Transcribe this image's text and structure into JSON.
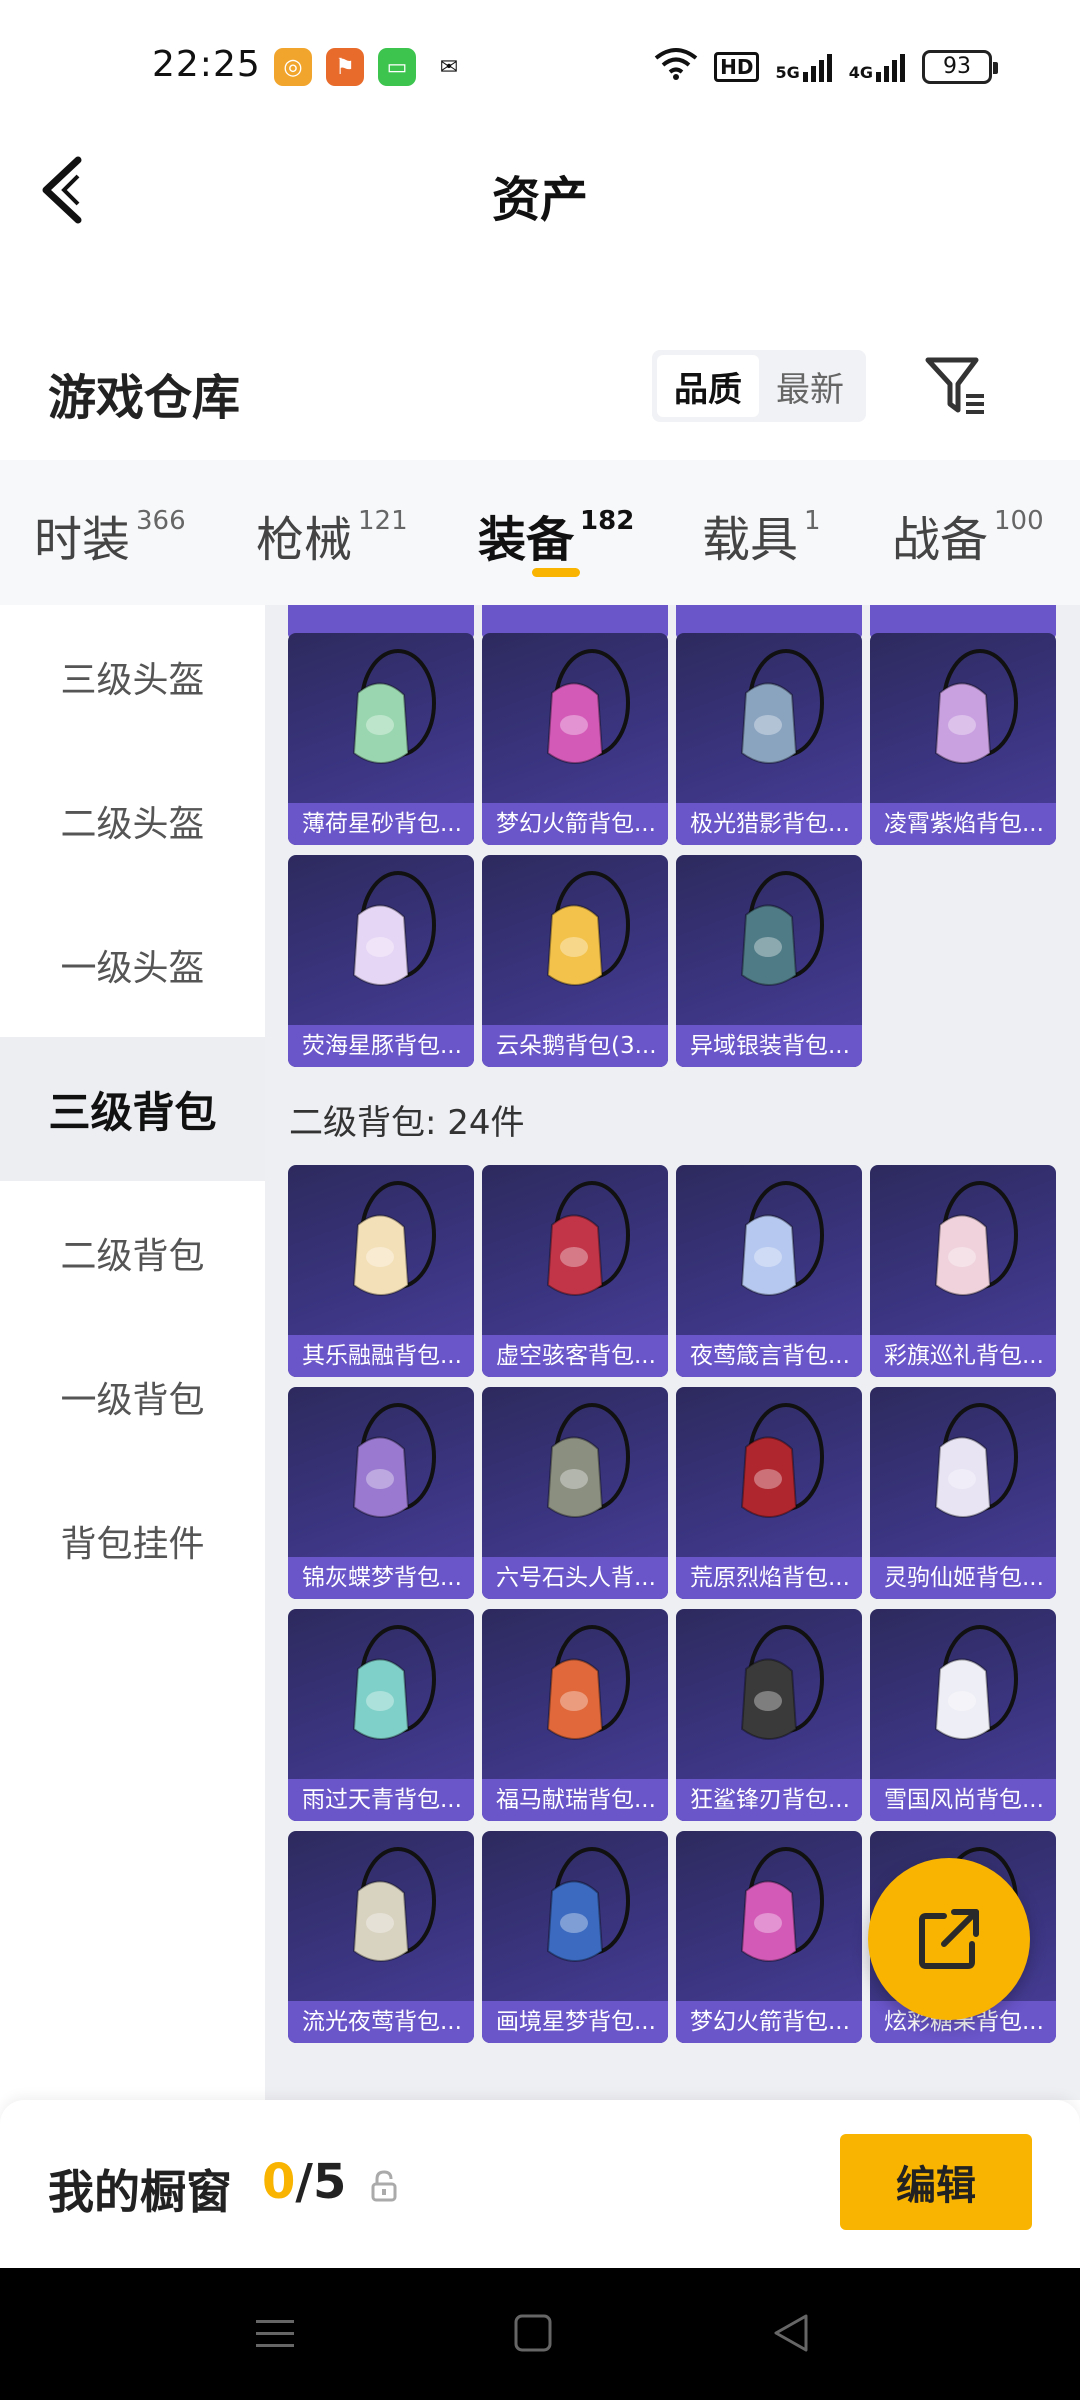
{
  "status_bar": {
    "time": "22:25",
    "network_hd": "HD",
    "signal_5g": "5G",
    "signal_4g": "4G",
    "battery": "93"
  },
  "header": {
    "title": "资产"
  },
  "warehouse": {
    "title": "游戏仓库",
    "sort_options": [
      "品质",
      "最新"
    ],
    "active_sort": "品质"
  },
  "tabs": [
    {
      "label": "时装",
      "count": "366"
    },
    {
      "label": "枪械",
      "count": "121"
    },
    {
      "label": "装备",
      "count": "182"
    },
    {
      "label": "载具",
      "count": "1"
    },
    {
      "label": "战备",
      "count": "100"
    }
  ],
  "active_tab": "装备",
  "sidebar": [
    {
      "label": "三级头盔"
    },
    {
      "label": "二级头盔"
    },
    {
      "label": "一级头盔"
    },
    {
      "label": "三级背包"
    },
    {
      "label": "二级背包"
    },
    {
      "label": "一级背包"
    },
    {
      "label": "背包挂件"
    }
  ],
  "active_sidebar": "三级背包",
  "level3_items": [
    {
      "label": "薄荷星砂背包...",
      "accent": "#9ad7b0"
    },
    {
      "label": "梦幻火箭背包...",
      "accent": "#d45ab8"
    },
    {
      "label": "极光猎影背包...",
      "accent": "#8aa4c0"
    },
    {
      "label": "凌霄紫焰背包...",
      "accent": "#c9a0e0"
    },
    {
      "label": "荧海星豚背包...",
      "accent": "#e6d6f5"
    },
    {
      "label": "云朵鹅背包(3...",
      "accent": "#f3c24a"
    },
    {
      "label": "异域银装背包...",
      "accent": "#4f7b86"
    }
  ],
  "level2_section": {
    "title": "二级背包: 24件"
  },
  "level2_items": [
    {
      "label": "其乐融融背包...",
      "accent": "#f4e0b8"
    },
    {
      "label": "虚空骇客背包...",
      "accent": "#c23448"
    },
    {
      "label": "夜莺箴言背包...",
      "accent": "#b6c8f0"
    },
    {
      "label": "彩旗巡礼背包...",
      "accent": "#f0d2dc"
    },
    {
      "label": "锦灰蝶梦背包...",
      "accent": "#9a7ad0"
    },
    {
      "label": "六号石头人背...",
      "accent": "#8a8f80"
    },
    {
      "label": "荒原烈焰背包...",
      "accent": "#b0262e"
    },
    {
      "label": "灵驹仙姬背包...",
      "accent": "#e8e4f4"
    },
    {
      "label": "雨过天青背包...",
      "accent": "#7fd0c8"
    },
    {
      "label": "福马献瑞背包...",
      "accent": "#e0683a"
    },
    {
      "label": "狂鲨锋刃背包...",
      "accent": "#3a3a3a"
    },
    {
      "label": "雪国风尚背包...",
      "accent": "#eeeef6"
    },
    {
      "label": "流光夜莺背包...",
      "accent": "#d8d2c0"
    },
    {
      "label": "画境星梦背包...",
      "accent": "#3b6ac0"
    },
    {
      "label": "梦幻火箭背包...",
      "accent": "#d45ab8"
    },
    {
      "label": "炫彩糖果背包...",
      "accent": "#f08ab0"
    }
  ],
  "bottom_bar": {
    "showcase_label": "我的橱窗",
    "current": "0",
    "separator_total": "/5",
    "edit_label": "编辑"
  },
  "colors": {
    "accent": "#f8b400",
    "tile_bg": "#3b3581",
    "tile_label_bg": "#6a55c9"
  }
}
